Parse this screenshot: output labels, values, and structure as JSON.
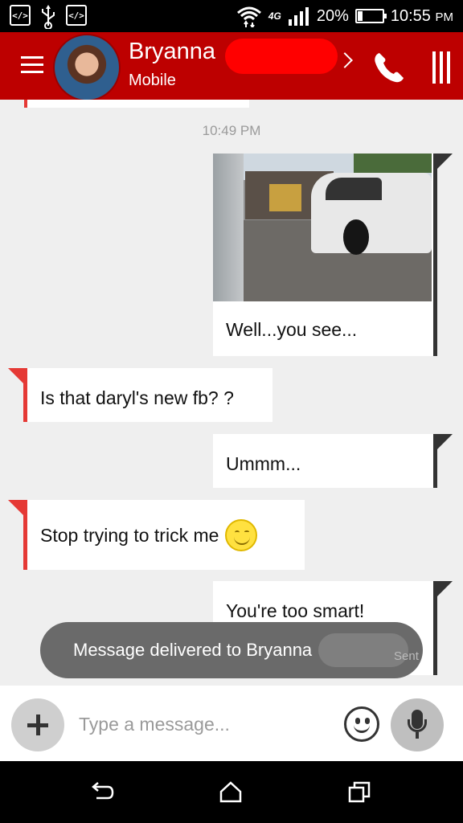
{
  "status_bar": {
    "network": "4G",
    "battery_percent": "20%",
    "battery_level": 0.2,
    "time": "10:55",
    "time_suffix": "PM"
  },
  "header": {
    "contact_name": "Bryanna",
    "contact_subtitle": "Mobile"
  },
  "timestamp": "10:49 PM",
  "messages": [
    {
      "direction": "outgoing",
      "has_image": true,
      "text": "Well...you see..."
    },
    {
      "direction": "incoming",
      "text": "Is that daryl's new fb? ?"
    },
    {
      "direction": "outgoing",
      "text": "Ummm..."
    },
    {
      "direction": "incoming",
      "text": "Stop trying to trick me",
      "emoji": "smiling-face"
    },
    {
      "direction": "outgoing",
      "text": "You're too smart!"
    }
  ],
  "toast": {
    "text": "Message delivered to Bryanna",
    "partial_status": "Sent"
  },
  "composer": {
    "placeholder": "Type a message..."
  },
  "colors": {
    "header": "#bd0000",
    "incoming_accent": "#e53935",
    "outgoing_accent": "#333333",
    "background": "#efefef"
  }
}
